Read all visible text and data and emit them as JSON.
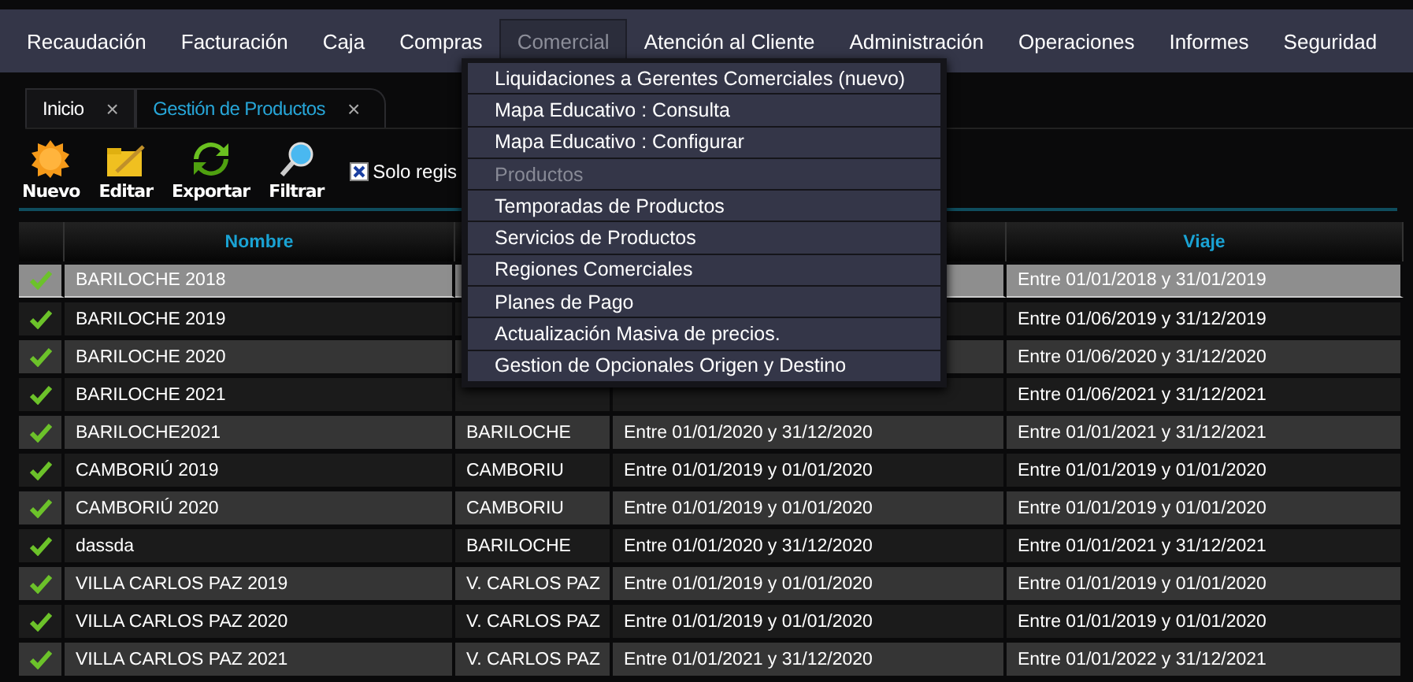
{
  "menu_bar": [
    {
      "label": "Recaudación",
      "open": false
    },
    {
      "label": "Facturación",
      "open": false
    },
    {
      "label": "Caja",
      "open": false
    },
    {
      "label": "Compras",
      "open": false
    },
    {
      "label": "Comercial",
      "open": true
    },
    {
      "label": "Atención al Cliente",
      "open": false
    },
    {
      "label": "Administración",
      "open": false
    },
    {
      "label": "Operaciones",
      "open": false
    },
    {
      "label": "Informes",
      "open": false
    },
    {
      "label": "Seguridad",
      "open": false
    }
  ],
  "dropdown": [
    {
      "label": "Liquidaciones a Gerentes Comerciales (nuevo)",
      "disabled": false
    },
    {
      "label": "Mapa Educativo : Consulta",
      "disabled": false
    },
    {
      "label": "Mapa Educativo : Configurar",
      "disabled": false
    },
    {
      "label": "Productos",
      "disabled": true
    },
    {
      "label": "Temporadas de Productos",
      "disabled": false
    },
    {
      "label": "Servicios de Productos",
      "disabled": false
    },
    {
      "label": "Regiones Comerciales",
      "disabled": false
    },
    {
      "label": "Planes de Pago",
      "disabled": false
    },
    {
      "label": "Actualización Masiva de precios.",
      "disabled": false
    },
    {
      "label": "Gestion de Opcionales Origen y Destino",
      "disabled": false
    }
  ],
  "tabs": [
    {
      "label": "Inicio",
      "close": "×",
      "selected": false
    },
    {
      "label": "Gestión de Productos",
      "close": "×",
      "selected": true
    }
  ],
  "toolbar": [
    {
      "kind": "new",
      "label": "Nuevo"
    },
    {
      "kind": "edit",
      "label": "Editar"
    },
    {
      "kind": "export",
      "label": "Exportar"
    },
    {
      "kind": "filter",
      "label": "Filtrar"
    }
  ],
  "filter_checkbox": {
    "label": "Solo regis",
    "checked": true
  },
  "table": {
    "columns": [
      "Nombre",
      "Viaje"
    ],
    "rows": [
      {
        "active": true,
        "selected": true,
        "name": "BARILOCHE 2018",
        "trip": "Entre 01/01/2018 y 31/01/2019"
      },
      {
        "active": true,
        "selected": false,
        "name": "BARILOCHE 2019",
        "trip": "Entre 01/06/2019 y 31/12/2019"
      },
      {
        "active": true,
        "selected": false,
        "name": "BARILOCHE 2020",
        "trip": "Entre 01/06/2020 y 31/12/2020"
      },
      {
        "active": true,
        "selected": false,
        "name": "BARILOCHE 2021",
        "trip": "Entre 01/06/2021 y 31/12/2021"
      },
      {
        "active": true,
        "selected": false,
        "name": "BARILOCHE2021",
        "region": "BARILOCHE",
        "period": "Entre 01/01/2020 y 31/12/2020",
        "trip": "Entre 01/01/2021 y 31/12/2021"
      },
      {
        "active": true,
        "selected": false,
        "name": "CAMBORIÚ 2019",
        "region": "CAMBORIU",
        "period": "Entre 01/01/2019 y 01/01/2020",
        "trip": "Entre 01/01/2019 y 01/01/2020"
      },
      {
        "active": true,
        "selected": false,
        "name": "CAMBORIÚ 2020",
        "region": "CAMBORIU",
        "period": "Entre 01/01/2019 y 01/01/2020",
        "trip": "Entre 01/01/2019 y 01/01/2020"
      },
      {
        "active": true,
        "selected": false,
        "name": "dassda",
        "region": "BARILOCHE",
        "period": "Entre 01/01/2020 y 31/12/2020",
        "trip": "Entre 01/01/2021 y 31/12/2021"
      },
      {
        "active": true,
        "selected": false,
        "name": "VILLA CARLOS PAZ 2019",
        "region": "V. CARLOS PAZ",
        "period": "Entre 01/01/2019 y 01/01/2020",
        "trip": "Entre 01/01/2019 y 01/01/2020"
      },
      {
        "active": true,
        "selected": false,
        "name": "VILLA CARLOS PAZ 2020",
        "region": "V. CARLOS PAZ",
        "period": "Entre 01/01/2019 y 01/01/2020",
        "trip": "Entre 01/01/2019 y 01/01/2020"
      },
      {
        "active": true,
        "selected": false,
        "name": "VILLA CARLOS PAZ 2021",
        "region": "V. CARLOS PAZ",
        "period": "Entre 01/01/2021 y 31/12/2020",
        "trip": "Entre 01/01/2022 y 31/12/2021"
      }
    ]
  }
}
